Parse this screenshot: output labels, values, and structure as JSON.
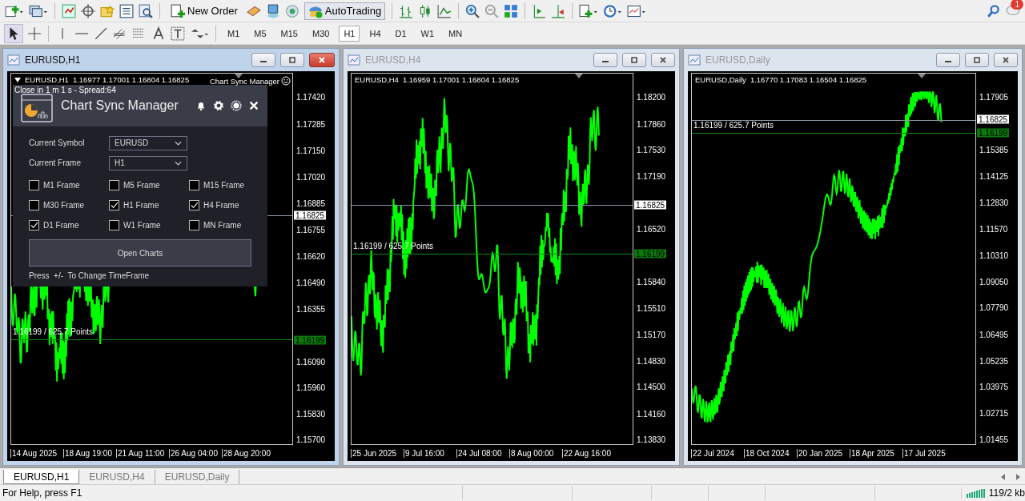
{
  "toolbar": {
    "new_order": "New Order",
    "autotrading": {
      "label": "AutoTrading",
      "on": true
    },
    "notification_count": "1"
  },
  "timeframes": [
    {
      "label": "M1",
      "selected": false
    },
    {
      "label": "M5",
      "selected": false
    },
    {
      "label": "M15",
      "selected": false
    },
    {
      "label": "M30",
      "selected": false
    },
    {
      "label": "H1",
      "selected": true
    },
    {
      "label": "H4",
      "selected": false
    },
    {
      "label": "D1",
      "selected": false
    },
    {
      "label": "W1",
      "selected": false
    },
    {
      "label": "MN",
      "selected": false
    }
  ],
  "charts": [
    {
      "title": "EURUSD,H1",
      "active": true,
      "symbol": "EURUSD,H1",
      "ohlc": "1.16977 1.17001 1.16804 1.16825",
      "indicator_label": "Chart Sync Manager",
      "countdown": "Close in 1 m 1 s - Spread:64",
      "yticks": [
        "1.17420",
        "1.17285",
        "1.17150",
        "1.17020",
        "1.16885",
        "1.16755",
        "1.16620",
        "1.16490",
        "1.16355",
        "1.16090",
        "1.15960",
        "1.15830",
        "1.15700"
      ],
      "xticks": [
        "14 Aug 2025",
        "18 Aug 19:00",
        "21 Aug 11:00",
        "26 Aug 04:00",
        "28 Aug 20:00"
      ],
      "price_tag": "1.16825",
      "level_tag": "1.16199",
      "level_label": "1.16199 / 625.7 Points",
      "panel": {
        "title": "Chart Sync Manager",
        "fields": [
          {
            "label": "Current Symbol",
            "value": "EURUSD"
          },
          {
            "label": "Current Frame",
            "value": "H1"
          }
        ],
        "frames": [
          {
            "label": "M1 Frame",
            "checked": false
          },
          {
            "label": "M5 Frame",
            "checked": false
          },
          {
            "label": "M15 Frame",
            "checked": false
          },
          {
            "label": "M30 Frame",
            "checked": false
          },
          {
            "label": "H1 Frame",
            "checked": true
          },
          {
            "label": "H4 Frame",
            "checked": true
          },
          {
            "label": "D1 Frame",
            "checked": true
          },
          {
            "label": "W1 Frame",
            "checked": false
          },
          {
            "label": "MN Frame",
            "checked": false
          }
        ],
        "button": "Open Charts",
        "hint": "Press  +/-  To Change TimeFrame"
      }
    },
    {
      "title": "EURUSD,H4",
      "active": false,
      "symbol": "EURUSD,H4",
      "ohlc": "1.16959 1.17001 1.16804 1.16825",
      "yticks": [
        "1.18200",
        "1.17860",
        "1.17530",
        "1.17190",
        "1.16520",
        "1.15840",
        "1.15510",
        "1.15170",
        "1.14830",
        "1.14500",
        "1.14160",
        "1.13830"
      ],
      "xticks": [
        "25 Jun 2025",
        "9 Jul 16:00",
        "24 Jul 08:00",
        "8 Aug 00:00",
        "22 Aug 16:00"
      ],
      "price_tag": "1.16825",
      "level_tag": "1.16199",
      "level_label": "1.16199 / 625.7 Points"
    },
    {
      "title": "EURUSD,Daily",
      "active": false,
      "symbol": "EURUSD,Daily",
      "ohlc": "1.16770 1.17083 1.16504 1.16825",
      "yticks": [
        "1.17905",
        "1.15385",
        "1.14125",
        "1.12830",
        "1.11570",
        "1.10310",
        "1.09050",
        "1.07790",
        "1.06495",
        "1.05235",
        "1.03975",
        "1.02715",
        "1.01455"
      ],
      "xticks": [
        "22 Jul 2024",
        "18 Oct 2024",
        "20 Jan 2025",
        "18 Apr 2025",
        "17 Jul 2025"
      ],
      "price_tag": "1.16825",
      "level_tag": "1.16199",
      "level_label": "1.16199 / 625.7 Points"
    }
  ],
  "tabs": [
    {
      "label": "EURUSD,H1",
      "selected": true
    },
    {
      "label": "EURUSD,H4",
      "selected": false
    },
    {
      "label": "EURUSD,Daily",
      "selected": false
    }
  ],
  "status_bar": {
    "help": "For Help, press F1",
    "traffic": "119/2 kb"
  }
}
